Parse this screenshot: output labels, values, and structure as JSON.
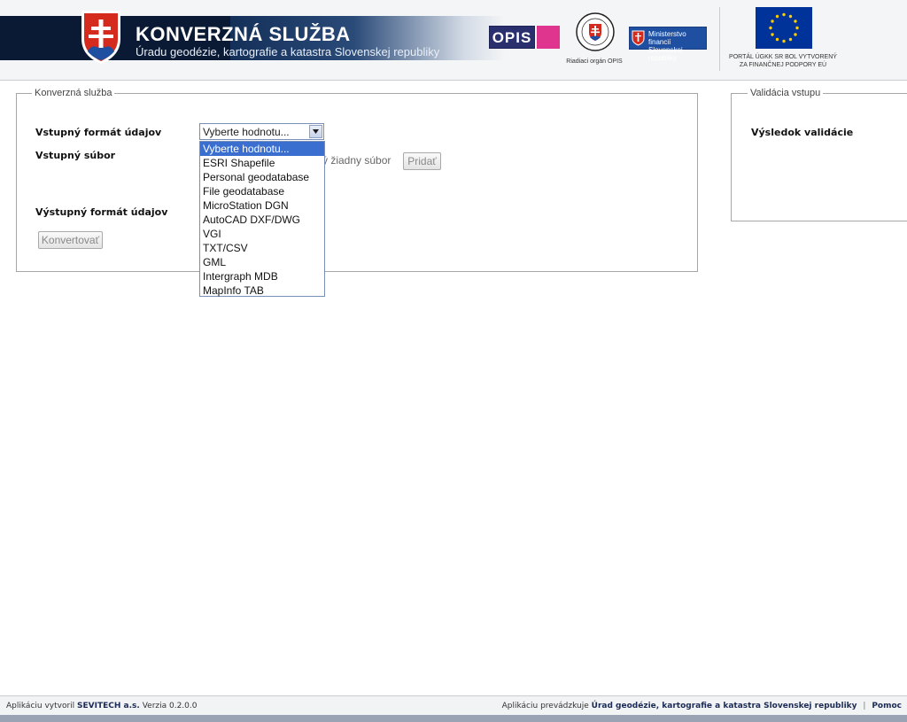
{
  "header": {
    "title": "KONVERZNÁ SLUŽBA",
    "subtitle": "Úradu geodézie, kartografie a katastra Slovenskej republiky",
    "opis_logo_text": "OPIS",
    "seal_caption": "Riadiaci orgán OPIS",
    "ministry_text": "Ministerstvo financií Slovenskej republiky",
    "eu_caption_line1": "PORTÁL ÚGKK SR BOL VYTVORENÝ",
    "eu_caption_line2": "ZA FINANČNEJ PODPORY EÚ",
    "colors": {
      "band": "#0f2a52",
      "opis_pink": "#e0358e",
      "opis_navy": "#2a2f6e",
      "ministry_blue": "#1f4fa0",
      "eu_blue": "#003399",
      "eu_stars": "#ffcc00"
    }
  },
  "conversion": {
    "legend": "Konverzná služba",
    "input_format_label": "Vstupný formát údajov",
    "input_file_label": "Vstupný súbor",
    "file_status": "atý žiadny súbor",
    "add_button": "Pridať",
    "output_format_label": "Výstupný formát údajov",
    "convert_button": "Konvertovať",
    "select": {
      "value": "Vyberte hodnotu...",
      "options": [
        "Vyberte hodnotu...",
        "ESRI Shapefile",
        "Personal geodatabase",
        "File geodatabase",
        "MicroStation DGN",
        "AutoCAD DXF/DWG",
        "VGI",
        "TXT/CSV",
        "GML",
        "Intergraph MDB",
        "MapInfo TAB"
      ],
      "highlighted_index": 0
    }
  },
  "validation": {
    "legend": "Validácia vstupu",
    "result_label": "Výsledok validácie"
  },
  "footer": {
    "created_by_prefix": "Aplikáciu vytvoril",
    "created_by_company": "SEVITECH a.s.",
    "version": "Verzia 0.2.0.0",
    "operated_by_prefix": "Aplikáciu prevádzkuje",
    "operated_by_org": "Úrad geodézie, kartografie a katastra Slovenskej republiky",
    "separator": "|",
    "help_link": "Pomoc"
  }
}
